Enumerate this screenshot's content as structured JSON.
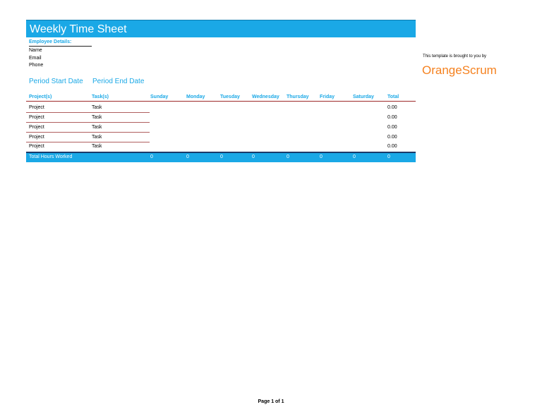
{
  "title": "Weekly Time Sheet",
  "employee": {
    "heading": "Employee Details:",
    "fields": [
      "Name",
      "Email",
      "Phone"
    ]
  },
  "period": {
    "start_label": "Period Start Date",
    "end_label": "Period End Date"
  },
  "table": {
    "headers": [
      "Project(s)",
      "Task(s)",
      "Sunday",
      "Monday",
      "Tuesday",
      "Wednesday",
      "Thursday",
      "Friday",
      "Saturday",
      "Total"
    ],
    "rows": [
      {
        "project": "Project",
        "task": "Task",
        "total": "0.00"
      },
      {
        "project": "Project",
        "task": "Task",
        "total": "0.00"
      },
      {
        "project": "Project",
        "task": "Task",
        "total": "0.00"
      },
      {
        "project": "Project",
        "task": "Task",
        "total": "0.00"
      },
      {
        "project": "Project",
        "task": "Task",
        "total": "0.00"
      }
    ],
    "totals": {
      "label": "Total Hours Worked",
      "values": [
        "0",
        "0",
        "0",
        "0",
        "0",
        "0",
        "0",
        "0"
      ]
    }
  },
  "branding": {
    "tagline": "This template is brought to you by",
    "logo_text": "OrangeScrum",
    "logo_color": "#f58220"
  },
  "accent_color": "#1aa8e6",
  "footer": "Page 1 of 1"
}
